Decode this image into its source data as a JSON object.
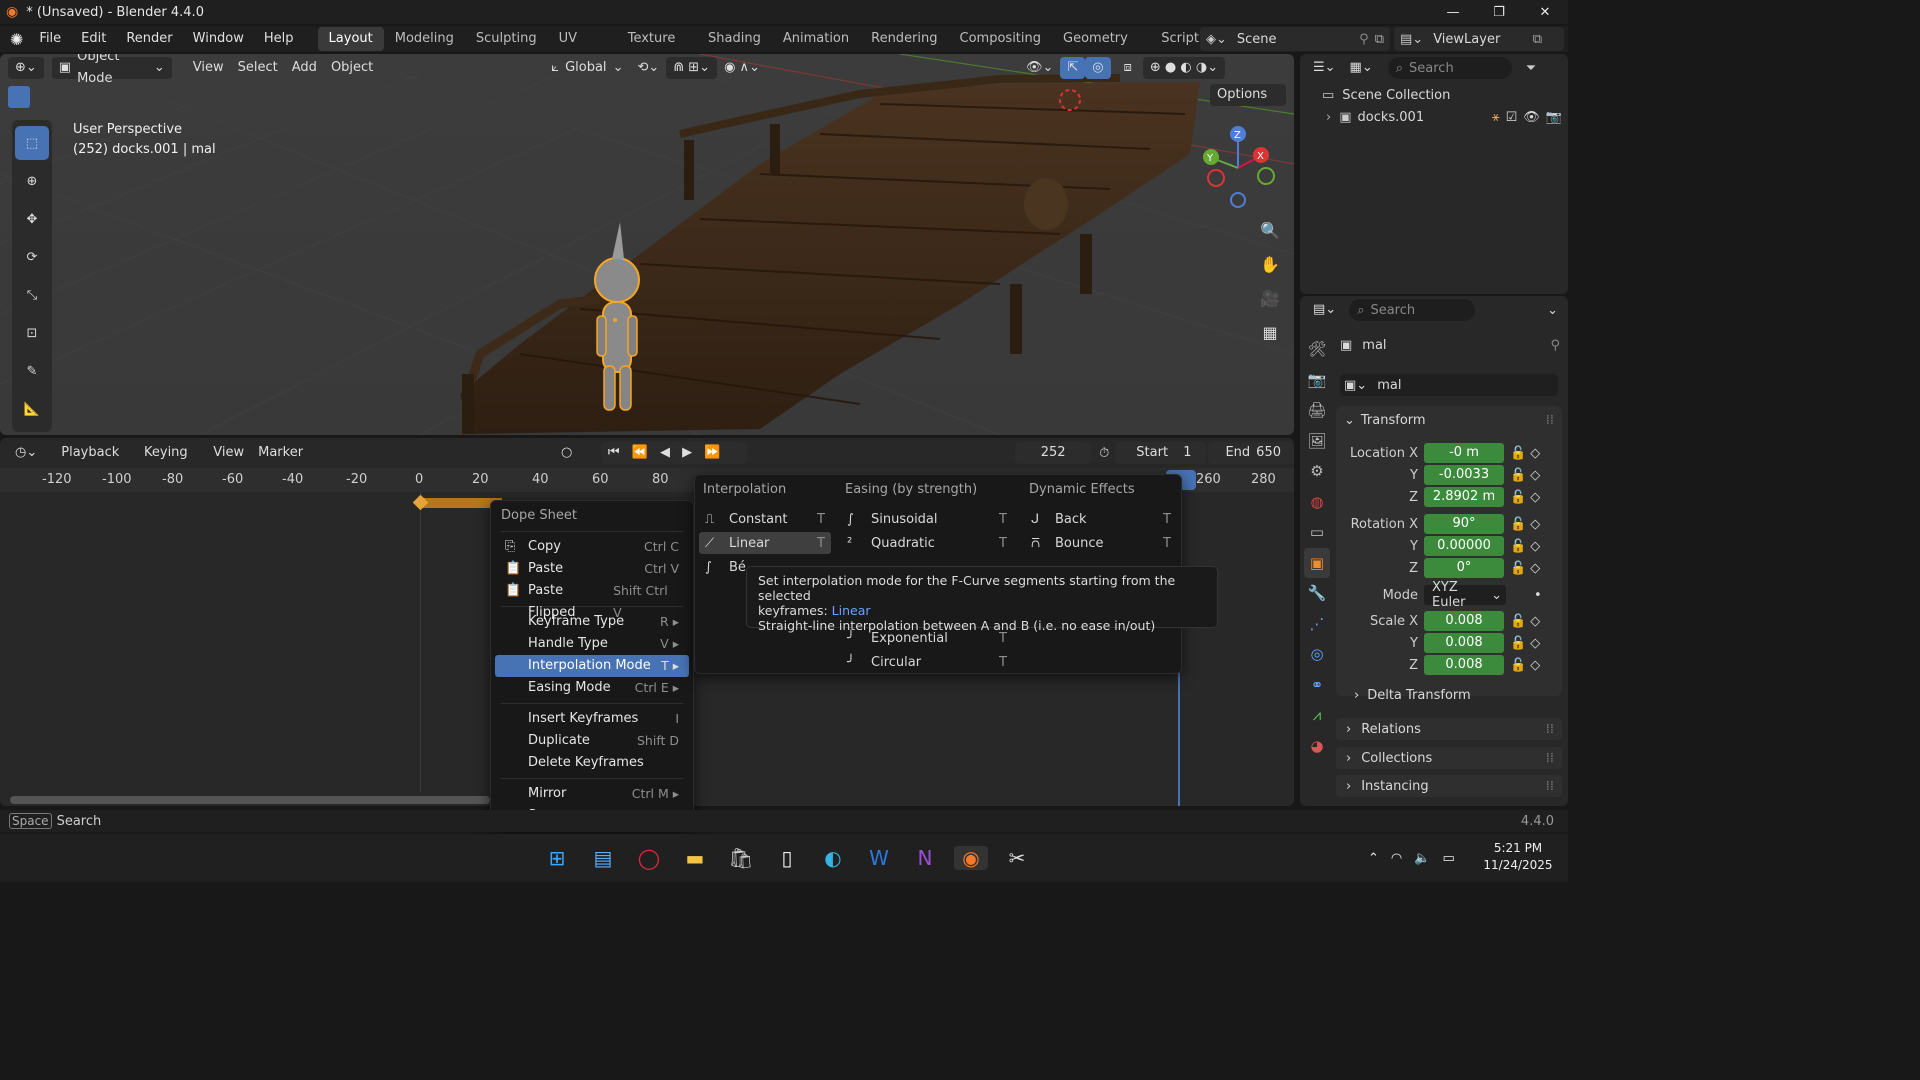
{
  "window": {
    "title": "* (Unsaved) - Blender 4.4.0"
  },
  "menubar": {
    "items": [
      "File",
      "Edit",
      "Render",
      "Window",
      "Help"
    ],
    "workspaces": [
      "Layout",
      "Modeling",
      "Sculpting",
      "UV Editing",
      "Texture Paint",
      "Shading",
      "Animation",
      "Rendering",
      "Compositing",
      "Geometry Nodes",
      "Scripti"
    ],
    "scene": "Scene",
    "view_layer": "ViewLayer"
  },
  "viewport": {
    "mode": "Object Mode",
    "menus": [
      "View",
      "Select",
      "Add",
      "Object"
    ],
    "orientation": "Global",
    "options": "Options",
    "overlay_title": "User Perspective",
    "overlay_subtitle": "(252) docks.001 | mal",
    "gizmo": {
      "x": "X",
      "y": "Y",
      "z": "Z"
    }
  },
  "timeline": {
    "menus": [
      "Playback",
      "Keying",
      "View",
      "Marker"
    ],
    "current_frame": "252",
    "start_label": "Start",
    "start_value": "1",
    "end_label": "End",
    "end_value": "650",
    "ruler": [
      "-120",
      "-100",
      "-80",
      "-60",
      "-40",
      "-20",
      "0",
      "20",
      "40",
      "60",
      "80",
      "260",
      "280"
    ]
  },
  "context_menu": {
    "title": "Dope Sheet",
    "items": [
      {
        "label": "Copy",
        "shortcut": "Ctrl C"
      },
      {
        "label": "Paste",
        "shortcut": "Ctrl V"
      },
      {
        "label": "Paste Flipped",
        "shortcut": "Shift Ctrl V"
      },
      {
        "label": "Keyframe Type",
        "shortcut": "R"
      },
      {
        "label": "Handle Type",
        "shortcut": "V"
      },
      {
        "label": "Interpolation Mode",
        "shortcut": "T"
      },
      {
        "label": "Easing Mode",
        "shortcut": "Ctrl E"
      },
      {
        "label": "Insert Keyframes",
        "shortcut": "I"
      },
      {
        "label": "Duplicate",
        "shortcut": "Shift D"
      },
      {
        "label": "Delete Keyframes",
        "shortcut": ""
      },
      {
        "label": "Mirror",
        "shortcut": "Ctrl M"
      },
      {
        "label": "Snap",
        "shortcut": ""
      }
    ]
  },
  "interp_menu": {
    "col1_title": "Interpolation",
    "col2_title": "Easing (by strength)",
    "col3_title": "Dynamic Effects",
    "col1": [
      {
        "label": "Constant",
        "shortcut": "T"
      },
      {
        "label": "Linear",
        "shortcut": "T"
      },
      {
        "label": "Bé",
        "shortcut": ""
      }
    ],
    "col2": [
      {
        "label": "Sinusoidal",
        "shortcut": "T"
      },
      {
        "label": "Quadratic",
        "shortcut": "T"
      },
      {
        "label": "Exponential",
        "shortcut": "T"
      },
      {
        "label": "Circular",
        "shortcut": "T"
      }
    ],
    "col3": [
      {
        "label": "Back",
        "shortcut": "T"
      },
      {
        "label": "Bounce",
        "shortcut": "T"
      }
    ]
  },
  "tooltip": {
    "line1": "Set interpolation mode for the F-Curve segments starting from the selected",
    "line2a": "keyframes: ",
    "line2b": "Linear",
    "line3": "Straight-line interpolation between A and B (i.e. no ease in/out)"
  },
  "outliner": {
    "search": "Search",
    "scene_collection": "Scene Collection",
    "object": "docks.001"
  },
  "properties": {
    "search": "Search",
    "object_name": "mal",
    "data_name": "mal",
    "transform": "Transform",
    "location": {
      "label": "Location X",
      "x": "-0 m",
      "y": "-0.0033",
      "z": "2.8902 m"
    },
    "rotation": {
      "label": "Rotation X",
      "x": "90°",
      "y": "0.00000",
      "z": "0°"
    },
    "mode": {
      "label": "Mode",
      "value": "XYZ Euler"
    },
    "scale": {
      "label": "Scale X",
      "x": "0.008",
      "y": "0.008",
      "z": "0.008"
    },
    "axis_y": "Y",
    "axis_z": "Z",
    "sections": [
      "Delta Transform",
      "Relations",
      "Collections",
      "Instancing"
    ]
  },
  "statusbar": {
    "key": "Space",
    "action": "Search",
    "version": "4.4.0"
  },
  "taskbar": {
    "time": "5:21 PM",
    "date": "11/24/2025"
  },
  "colors": {
    "accent": "#4772b3",
    "field_green": "#3c8a3c",
    "keyframe": "#e8a33a",
    "selection": "#f5a623"
  }
}
